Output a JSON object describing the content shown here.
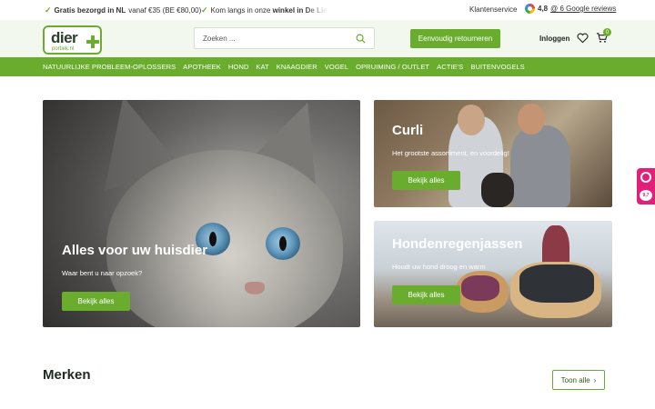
{
  "topbar": {
    "usp1_bold": "Gratis bezorgd in NL",
    "usp1_rest": "vanaf €35 (BE €80,00)",
    "usp2_prefix": "Kom langs in onze",
    "usp2_bold": "winkel in De Lie",
    "customer_service": "Klantenservice",
    "google_rating": "4,8",
    "google_reviews": "@ 6 Google reviews"
  },
  "header": {
    "logo_word": "dier",
    "logo_sub": "portiek.nl",
    "search_placeholder": "Zoeken ...",
    "return_button": "Eenvoudig retourneren",
    "login": "Inloggen",
    "cart_count": "0"
  },
  "nav": {
    "items": [
      "NATUURLIJKE PROBLEEM-OPLOSSERS",
      "APOTHEEK",
      "HOND",
      "KAT",
      "KNAAGDIER",
      "VOGEL",
      "OPRUIMING / OUTLET",
      "ACTIE'S",
      "BUITENVOGELS"
    ]
  },
  "heroes": {
    "main": {
      "title": "Alles voor uw huisdier",
      "subtitle": "Waar bent u naar opzoek?",
      "button": "Bekijk alles"
    },
    "curli": {
      "title": "Curli",
      "subtitle": "Het grootste assortiment, en voordelig!",
      "button": "Bekijk alles"
    },
    "rain": {
      "title": "Hondenregenjassen",
      "subtitle": "Houdt uw hond droog en warm",
      "button": "Bekijk alles"
    }
  },
  "side_badge": {
    "score": "9,7"
  },
  "brands": {
    "title": "Merken",
    "button": "Toon alle"
  },
  "colors": {
    "primary": "#6aac2e",
    "header_bg": "#f3f8ef",
    "badge": "#e2207a"
  }
}
